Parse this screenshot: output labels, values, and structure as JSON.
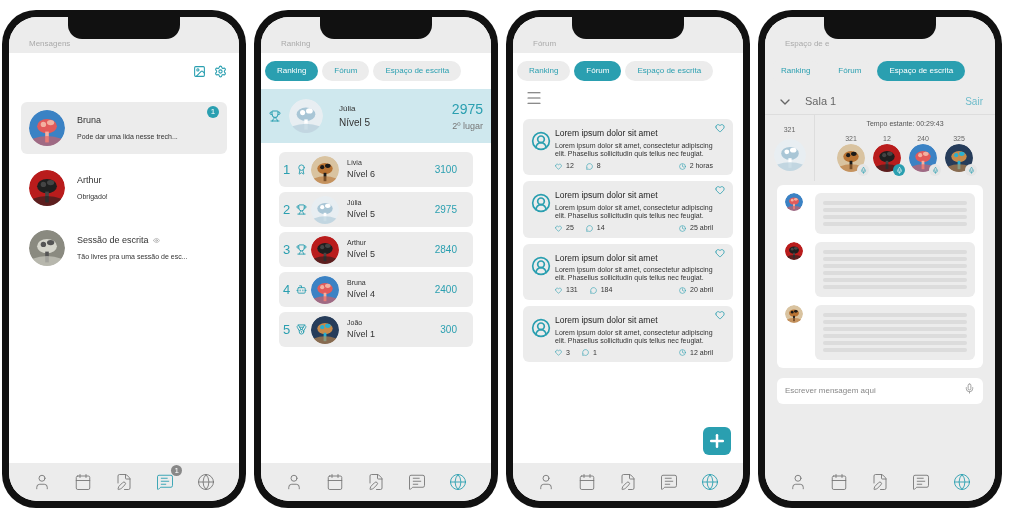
{
  "phones": [
    {
      "kind": "messages",
      "title": "Mensagens",
      "chats": [
        {
          "name": "Bruna",
          "preview": "Pode dar uma lida nesse trech...",
          "unread": "1",
          "selected": true
        },
        {
          "name": "Arthur",
          "preview": "Obrigado!",
          "selected": false
        },
        {
          "name": "Sessão de escrita",
          "preview": "Tão livres pra uma sessão de esc...",
          "selected": false
        }
      ],
      "nav": [
        {
          "selected": false
        },
        {
          "selected": false
        },
        {
          "selected": false
        },
        {
          "selected": true,
          "badge": "1"
        },
        {
          "selected": false
        }
      ]
    },
    {
      "kind": "ranking",
      "title": "Ranking",
      "tabs": [
        {
          "label": "Ranking",
          "selected": true
        },
        {
          "label": "Fórum",
          "selected": false
        },
        {
          "label": "Espaço de escrita",
          "selected": false
        }
      ],
      "me": {
        "name": "Júlia",
        "level": "Nível 5",
        "points": "2975",
        "place": "2º lugar"
      },
      "rows": [
        {
          "rank": "1",
          "name": "Lívia",
          "level": "Nível 6",
          "points": "3100"
        },
        {
          "rank": "2",
          "name": "Júlia",
          "level": "Nível 5",
          "points": "2975"
        },
        {
          "rank": "3",
          "name": "Arthur",
          "level": "Nível 5",
          "points": "2840"
        },
        {
          "rank": "4",
          "name": "Bruna",
          "level": "Nível 4",
          "points": "2400"
        },
        {
          "rank": "5",
          "name": "João",
          "level": "Nível 1",
          "points": "300"
        }
      ],
      "nav": [
        {
          "selected": false
        },
        {
          "selected": false
        },
        {
          "selected": false
        },
        {
          "selected": false
        },
        {
          "selected": true
        }
      ]
    },
    {
      "kind": "forum",
      "title": "Fórum",
      "tabs": [
        {
          "label": "Ranking",
          "selected": false
        },
        {
          "label": "Fórum",
          "selected": true
        },
        {
          "label": "Espaço de escrita",
          "selected": false
        }
      ],
      "posts": [
        {
          "title": "Lorem ipsum dolor sit amet",
          "body": "Lorem ipsum dolor sit amet, consectetur adipiscing elit. Phasellus sollicitudin quis tellus nec feugiat.",
          "likes": "12",
          "comments": "8",
          "time": "2 horas"
        },
        {
          "title": "Lorem ipsum dolor sit amet",
          "body": "Lorem ipsum dolor sit amet, consectetur adipiscing elit. Phasellus sollicitudin quis tellus nec feugiat.",
          "likes": "25",
          "comments": "14",
          "time": "25 abril"
        },
        {
          "title": "Lorem ipsum dolor sit amet",
          "body": "Lorem ipsum dolor sit amet, consectetur adipiscing elit. Phasellus sollicitudin quis tellus nec feugiat.",
          "likes": "131",
          "comments": "184",
          "time": "20 abril"
        },
        {
          "title": "Lorem ipsum dolor sit amet",
          "body": "Lorem ipsum dolor sit amet, consectetur adipiscing elit. Phasellus sollicitudin quis tellus nec feugiat.",
          "likes": "3",
          "comments": "1",
          "time": "12 abril"
        }
      ],
      "nav": [
        {
          "selected": false
        },
        {
          "selected": false
        },
        {
          "selected": false
        },
        {
          "selected": false
        },
        {
          "selected": true
        }
      ]
    },
    {
      "kind": "room",
      "title": "Espaço de e",
      "tabs": [
        {
          "label": "Ranking",
          "selected": false
        },
        {
          "label": "Fórum",
          "selected": false
        },
        {
          "label": "Espaço de escrita",
          "selected": true
        }
      ],
      "room": "Sala 1",
      "exit": "Sair",
      "timer": "Tempo estante: 00:29:43",
      "host_count": "321",
      "participants": [
        {
          "count": "321",
          "speaking": false
        },
        {
          "count": "12",
          "speaking": true
        },
        {
          "count": "240",
          "speaking": false
        },
        {
          "count": "325",
          "speaking": false
        }
      ],
      "messages": [
        {
          "kind": "placeholder"
        },
        {
          "kind": "placeholder"
        },
        {
          "kind": "placeholder"
        }
      ],
      "input": {
        "placeholder": "Escrever mensagem aqui"
      },
      "nav": [
        {
          "selected": false
        },
        {
          "selected": false
        },
        {
          "selected": false
        },
        {
          "selected": false
        },
        {
          "selected": true
        }
      ]
    }
  ]
}
